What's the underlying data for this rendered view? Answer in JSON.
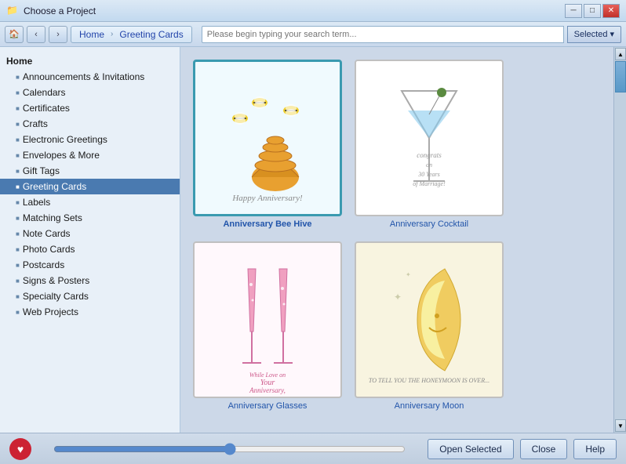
{
  "window": {
    "title": "Choose a Project",
    "icon": "📁"
  },
  "titlebar": {
    "minimize_label": "─",
    "maximize_label": "□",
    "close_label": "✕"
  },
  "navbar": {
    "home_label": "Home",
    "breadcrumb1": "Home",
    "breadcrumb2": "Greeting Cards",
    "search_placeholder": "Please begin typing your search term...",
    "selected_label": "Selected",
    "dropdown_arrow": "▾"
  },
  "sidebar": {
    "home_label": "Home",
    "items": [
      {
        "label": "Announcements & Invitations"
      },
      {
        "label": "Calendars"
      },
      {
        "label": "Certificates"
      },
      {
        "label": "Crafts"
      },
      {
        "label": "Electronic Greetings"
      },
      {
        "label": "Envelopes & More"
      },
      {
        "label": "Gift Tags"
      },
      {
        "label": "Greeting Cards",
        "active": true
      },
      {
        "label": "Labels"
      },
      {
        "label": "Matching Sets"
      },
      {
        "label": "Note Cards"
      },
      {
        "label": "Photo Cards"
      },
      {
        "label": "Postcards"
      },
      {
        "label": "Signs & Posters"
      },
      {
        "label": "Specialty Cards"
      },
      {
        "label": "Web Projects"
      }
    ]
  },
  "cards": [
    {
      "id": "bee-hive",
      "label": "Anniversary Bee Hive",
      "selected": true,
      "caption": "Happy Anniversary!",
      "type": "bee-hive"
    },
    {
      "id": "cocktail",
      "label": "Anniversary Cocktail",
      "selected": false,
      "type": "cocktail"
    },
    {
      "id": "glasses",
      "label": "Anniversary Glasses",
      "selected": false,
      "type": "glasses"
    },
    {
      "id": "moon",
      "label": "Anniversary Moon",
      "selected": false,
      "type": "moon"
    }
  ],
  "buttons": {
    "open_selected": "Open Selected",
    "close": "Close",
    "help": "Help"
  },
  "colors": {
    "accent": "#4a7ab0",
    "selected_border": "#3a9ab0"
  }
}
